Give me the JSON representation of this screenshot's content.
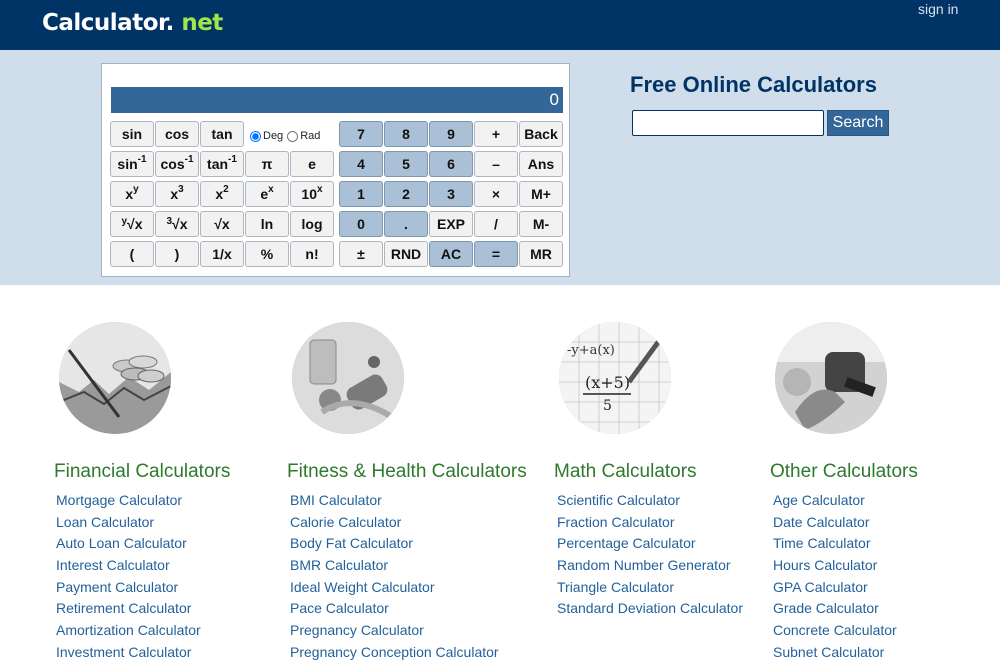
{
  "header": {
    "logo_main": "Calculator",
    "logo_dot": ".",
    "logo_suffix": "net",
    "sign_in": "sign in"
  },
  "calculator": {
    "display": "0",
    "angle_modes": [
      "Deg",
      "Rad"
    ],
    "selected_angle_mode": "Deg",
    "keys": {
      "sin": "sin",
      "cos": "cos",
      "tan": "tan",
      "asin_base": "sin",
      "acos_base": "cos",
      "atan_base": "tan",
      "inv_sup": "-1",
      "pow_base": "x",
      "pow_sup": "y",
      "cube_base": "x",
      "cube_sup": "3",
      "sq_base": "x",
      "sq_sup": "2",
      "exp_base": "e",
      "exp_sup": "x",
      "ten_base": "10",
      "ten_sup": "x",
      "yroot_pre": "y",
      "yroot_main": "√x",
      "croot_pre": "3",
      "croot_main": "√x",
      "sqrt": "√x",
      "ln": "ln",
      "log": "log",
      "lparen": "(",
      "rparen": ")",
      "recip": "1/x",
      "percent": "%",
      "fact": "n!",
      "pi": "π",
      "e": "e",
      "d7": "7",
      "d8": "8",
      "d9": "9",
      "plus": "+",
      "back": "Back",
      "d4": "4",
      "d5": "5",
      "d6": "6",
      "minus": "–",
      "ans": "Ans",
      "d1": "1",
      "d2": "2",
      "d3": "3",
      "times": "×",
      "mplus": "M+",
      "d0": "0",
      "dot": ".",
      "exp": "EXP",
      "divide": "/",
      "mminus": "M-",
      "plusminus": "±",
      "rnd": "RND",
      "ac": "AC",
      "equals": "=",
      "mr": "MR"
    }
  },
  "search": {
    "title": "Free Online Calculators",
    "placeholder": "",
    "button": "Search"
  },
  "categories": [
    {
      "title": "Financial Calculators",
      "links": [
        "Mortgage Calculator",
        "Loan Calculator",
        "Auto Loan Calculator",
        "Interest Calculator",
        "Payment Calculator",
        "Retirement Calculator",
        "Amortization Calculator",
        "Investment Calculator"
      ]
    },
    {
      "title": "Fitness & Health Calculators",
      "links": [
        "BMI Calculator",
        "Calorie Calculator",
        "Body Fat Calculator",
        "BMR Calculator",
        "Ideal Weight Calculator",
        "Pace Calculator",
        "Pregnancy Calculator",
        "Pregnancy Conception Calculator"
      ]
    },
    {
      "title": "Math Calculators",
      "links": [
        "Scientific Calculator",
        "Fraction Calculator",
        "Percentage Calculator",
        "Random Number Generator",
        "Triangle Calculator",
        "Standard Deviation Calculator"
      ]
    },
    {
      "title": "Other Calculators",
      "links": [
        "Age Calculator",
        "Date Calculator",
        "Time Calculator",
        "Hours Calculator",
        "GPA Calculator",
        "Grade Calculator",
        "Concrete Calculator",
        "Subnet Calculator"
      ]
    }
  ],
  "colors": {
    "header_bg": "#003366",
    "band_bg": "#d0ddea",
    "display_bg": "#336699",
    "category_title": "#2d7a2d",
    "link": "#24619b"
  }
}
